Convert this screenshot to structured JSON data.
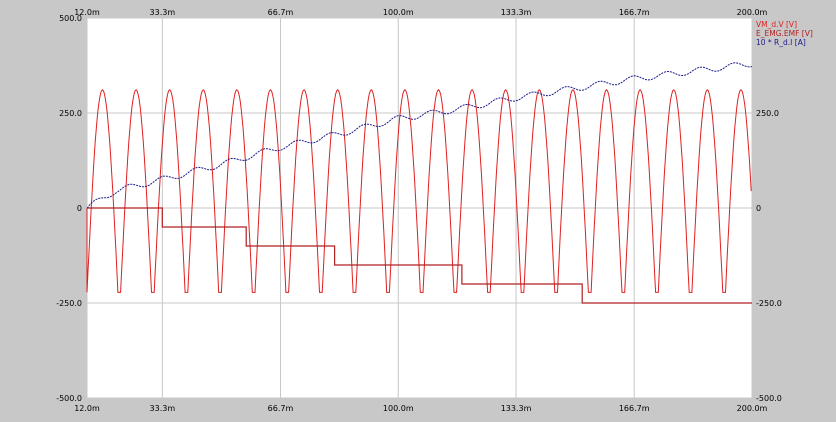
{
  "chart_data": {
    "type": "line",
    "x_axis": {
      "range": [
        12.0,
        200.0
      ],
      "unit": "ms",
      "tick_values": [
        12.0,
        33.3,
        66.7,
        100.0,
        133.3,
        166.7,
        200.0
      ],
      "tick_labels": [
        "12.0m",
        "33.3m",
        "66.7m",
        "100.0m",
        "133.3m",
        "166.7m",
        "200.0m"
      ]
    },
    "y_axis": {
      "range": [
        -500,
        500
      ],
      "left_tick_values": [
        500,
        250,
        0,
        -250,
        -500
      ],
      "left_tick_labels": [
        "500.0",
        "250.0",
        "0",
        "-250.0",
        "-500.0"
      ],
      "right_tick_values": [
        250,
        0,
        -250,
        -500
      ],
      "right_tick_labels": [
        "250.0",
        "0",
        "-250.0",
        "-500.0"
      ]
    },
    "grid": true,
    "legend_position": "top-right",
    "series": [
      {
        "name": "VM_d.V [V]",
        "color": "#e02020",
        "kind": "full-wave rectified sine (periodically reset)",
        "peak": 311,
        "trough": -222,
        "period_ms": 9.5
      },
      {
        "name": "E_EMG.EMF [V]",
        "color": "#b02020",
        "kind": "step",
        "x": [
          12.0,
          33.3,
          57.0,
          82.0,
          118.0,
          152.0,
          200.0
        ],
        "y": [
          0,
          -50,
          -100,
          -150,
          -200,
          -250,
          -250
        ]
      },
      {
        "name": "10 * R_d.I [A]",
        "color": "#1a1a8c",
        "kind": "rising line with ripple",
        "x": [
          12,
          20,
          33.3,
          50,
          66.7,
          83.3,
          100,
          116.7,
          133.3,
          150,
          166.7,
          183.3,
          200
        ],
        "y": [
          0,
          45,
          75,
          115,
          160,
          195,
          235,
          260,
          290,
          315,
          340,
          360,
          380
        ]
      }
    ]
  }
}
